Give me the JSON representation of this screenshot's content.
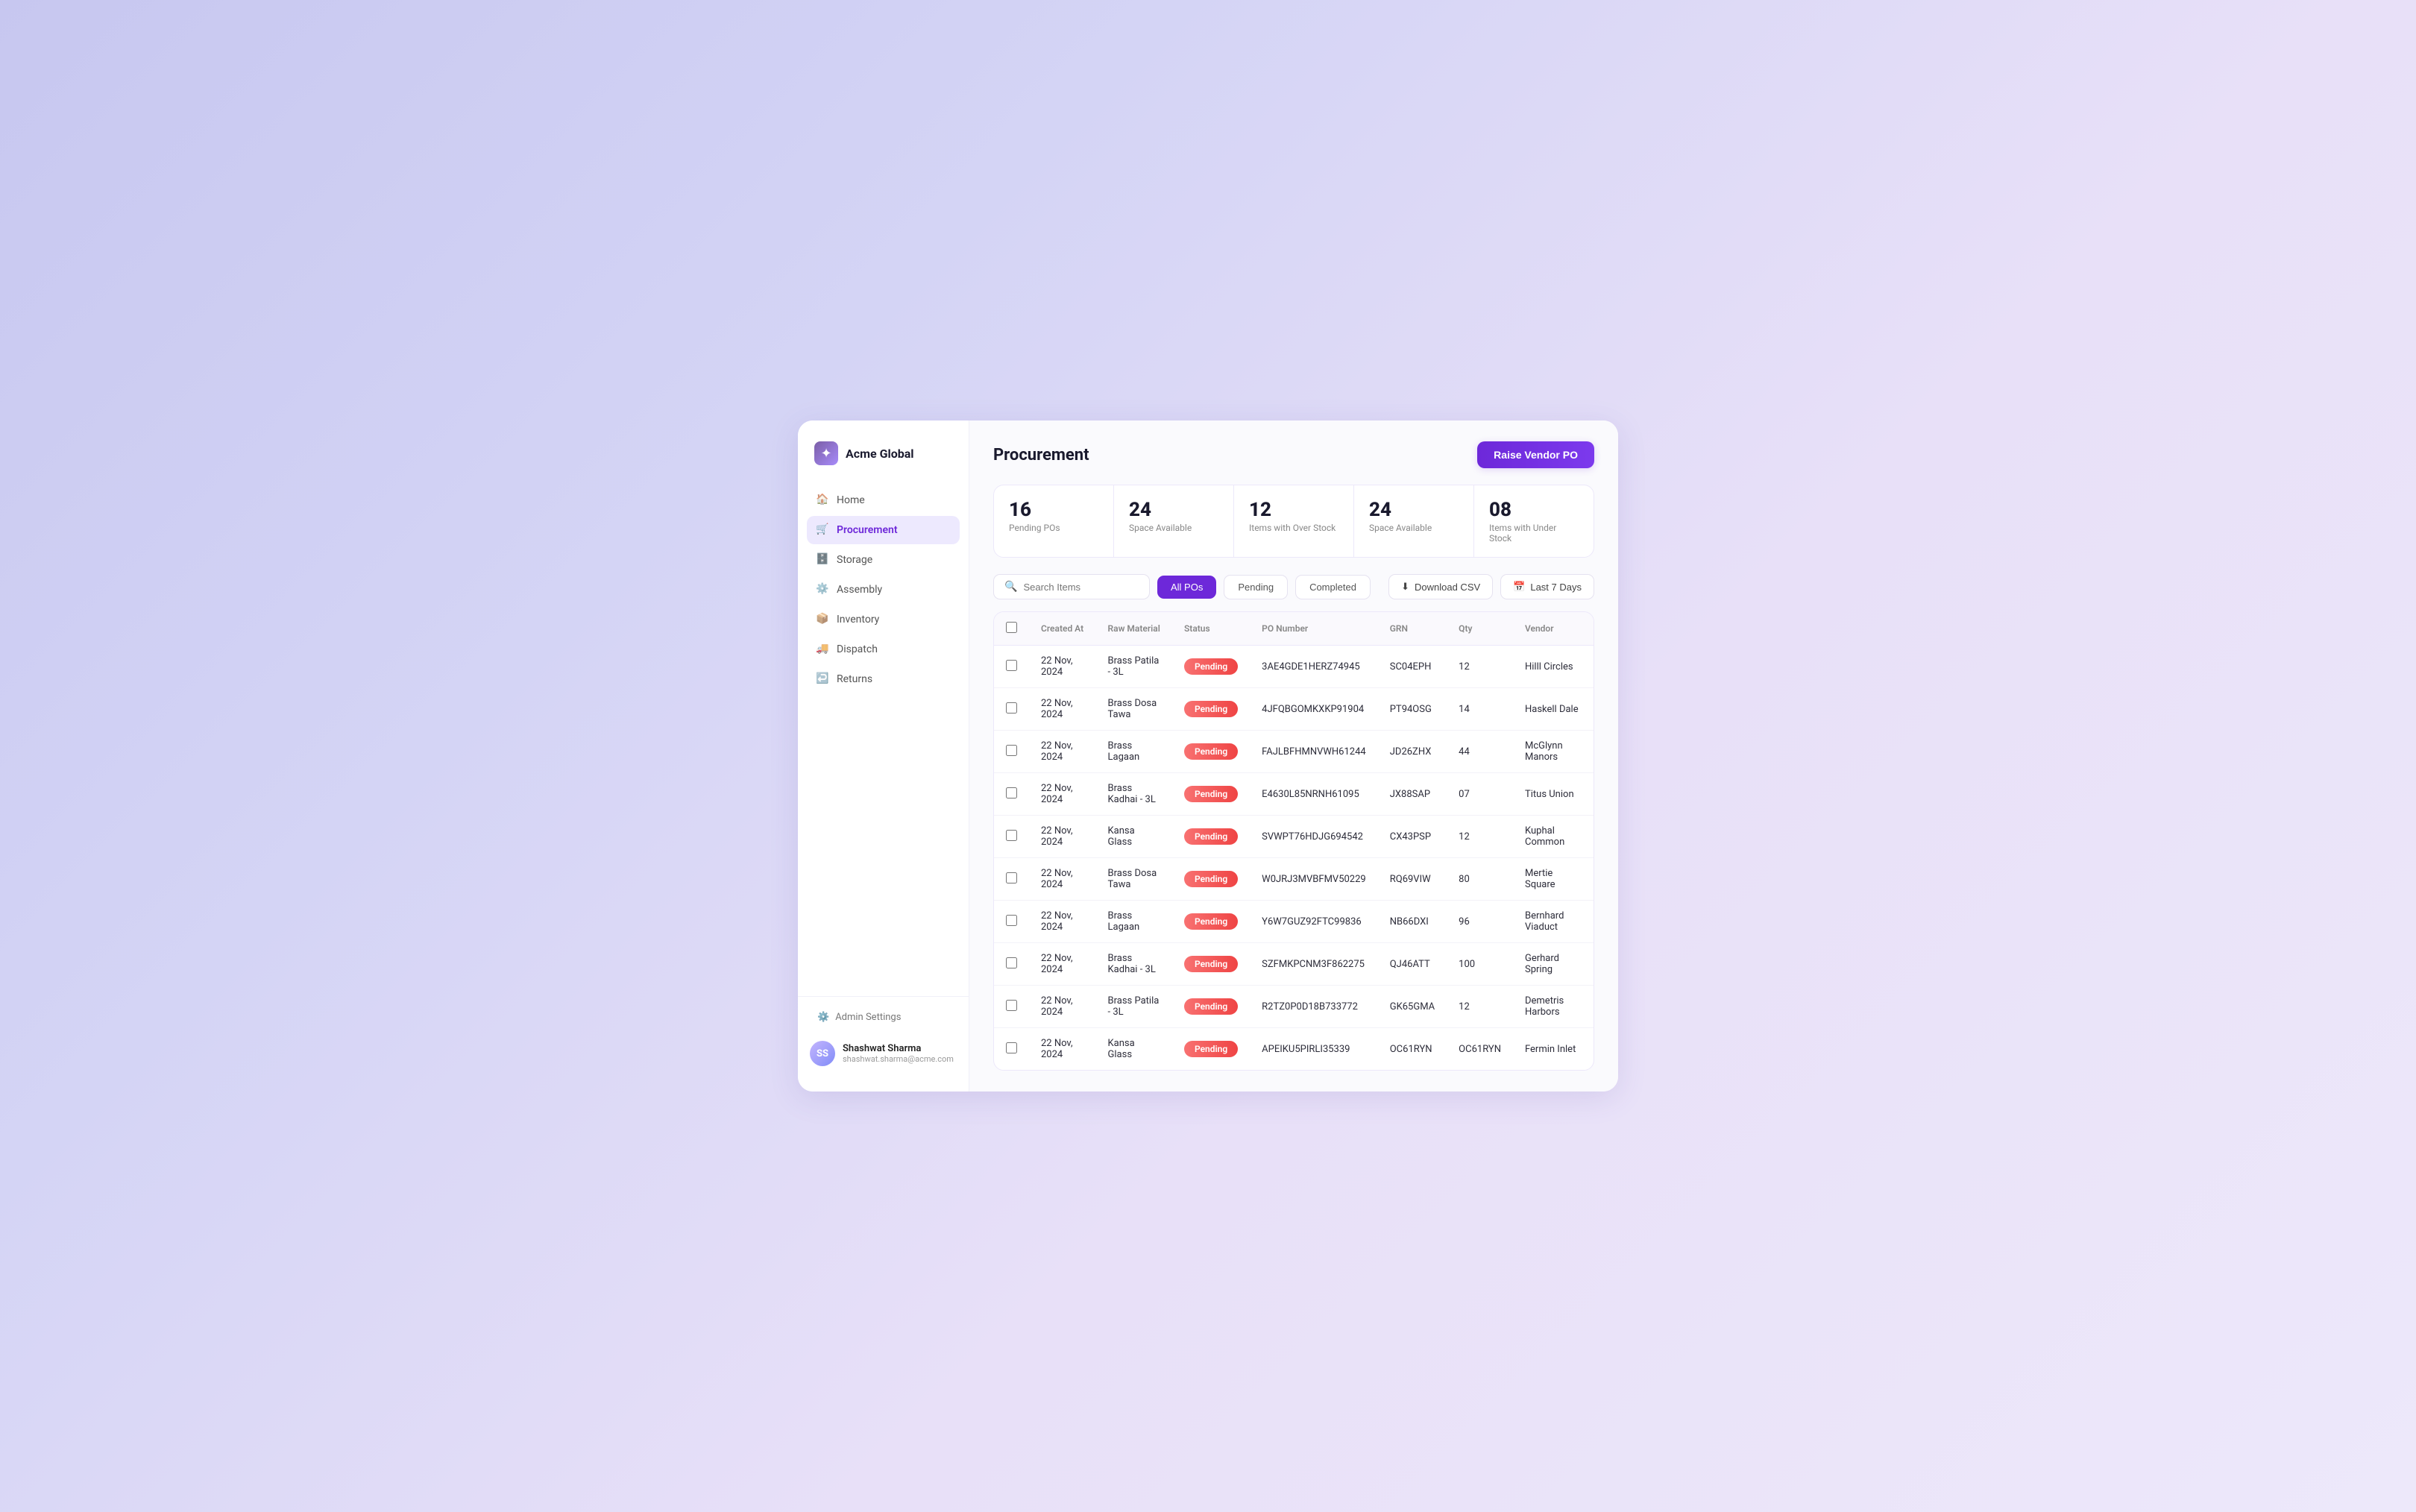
{
  "app": {
    "name": "Acme Global",
    "logo_char": "✦"
  },
  "sidebar": {
    "nav_items": [
      {
        "id": "home",
        "label": "Home",
        "icon": "🏠",
        "active": false
      },
      {
        "id": "procurement",
        "label": "Procurement",
        "icon": "🛒",
        "active": true
      },
      {
        "id": "storage",
        "label": "Storage",
        "icon": "🗄️",
        "active": false
      },
      {
        "id": "assembly",
        "label": "Assembly",
        "icon": "⚙️",
        "active": false
      },
      {
        "id": "inventory",
        "label": "Inventory",
        "icon": "📦",
        "active": false
      },
      {
        "id": "dispatch",
        "label": "Dispatch",
        "icon": "🚚",
        "active": false
      },
      {
        "id": "returns",
        "label": "Returns",
        "icon": "↩️",
        "active": false
      }
    ],
    "admin_settings_label": "Admin Settings",
    "user": {
      "name": "Shashwat Sharma",
      "email": "shashwat.sharma@acme.com",
      "initials": "SS"
    }
  },
  "header": {
    "title": "Procurement",
    "raise_po_label": "Raise Vendor PO"
  },
  "stats": [
    {
      "value": "16",
      "label": "Pending POs"
    },
    {
      "value": "24",
      "label": "Space Available"
    },
    {
      "value": "12",
      "label": "Items with Over Stock"
    },
    {
      "value": "24",
      "label": "Space Available"
    },
    {
      "value": "08",
      "label": "Items with Under Stock"
    }
  ],
  "toolbar": {
    "search_placeholder": "Search Items",
    "filters": [
      {
        "id": "all_pos",
        "label": "All POs",
        "active": true
      },
      {
        "id": "pending",
        "label": "Pending",
        "active": false
      },
      {
        "id": "completed",
        "label": "Completed",
        "active": false
      }
    ],
    "download_csv_label": "Download CSV",
    "date_filter_label": "Last 7 Days"
  },
  "table": {
    "columns": [
      "Created At",
      "Raw Material",
      "Status",
      "PO Number",
      "GRN",
      "Qty",
      "Vendor"
    ],
    "rows": [
      {
        "created_at": "22 Nov, 2024",
        "raw_material": "Brass Patila - 3L",
        "status": "Pending",
        "po_number": "3AE4GDE1HERZ74945",
        "grn": "SC04EPH",
        "qty": "12",
        "vendor": "Hilll Circles"
      },
      {
        "created_at": "22 Nov, 2024",
        "raw_material": "Brass Dosa Tawa",
        "status": "Pending",
        "po_number": "4JFQBGOMKXKP91904",
        "grn": "PT94OSG",
        "qty": "14",
        "vendor": "Haskell Dale"
      },
      {
        "created_at": "22 Nov, 2024",
        "raw_material": "Brass Lagaan",
        "status": "Pending",
        "po_number": "FAJLBFHMNVWH61244",
        "grn": "JD26ZHX",
        "qty": "44",
        "vendor": "McGlynn Manors"
      },
      {
        "created_at": "22 Nov, 2024",
        "raw_material": "Brass Kadhai - 3L",
        "status": "Pending",
        "po_number": "E4630L85NRNH61095",
        "grn": "JX88SAP",
        "qty": "07",
        "vendor": "Titus Union"
      },
      {
        "created_at": "22 Nov, 2024",
        "raw_material": "Kansa Glass",
        "status": "Pending",
        "po_number": "SVWPT76HDJG694542",
        "grn": "CX43PSP",
        "qty": "12",
        "vendor": "Kuphal Common"
      },
      {
        "created_at": "22 Nov, 2024",
        "raw_material": "Brass Dosa Tawa",
        "status": "Pending",
        "po_number": "W0JRJ3MVBFMV50229",
        "grn": "RQ69VIW",
        "qty": "80",
        "vendor": "Mertie Square"
      },
      {
        "created_at": "22 Nov, 2024",
        "raw_material": "Brass Lagaan",
        "status": "Pending",
        "po_number": "Y6W7GUZ92FTC99836",
        "grn": "NB66DXI",
        "qty": "96",
        "vendor": "Bernhard Viaduct"
      },
      {
        "created_at": "22 Nov, 2024",
        "raw_material": "Brass Kadhai - 3L",
        "status": "Pending",
        "po_number": "SZFMKPCNM3F862275",
        "grn": "QJ46ATT",
        "qty": "100",
        "vendor": "Gerhard Spring"
      },
      {
        "created_at": "22 Nov, 2024",
        "raw_material": "Brass Patila - 3L",
        "status": "Pending",
        "po_number": "R2TZ0P0D18B733772",
        "grn": "GK65GMA",
        "qty": "12",
        "vendor": "Demetris Harbors"
      },
      {
        "created_at": "22 Nov, 2024",
        "raw_material": "Kansa Glass",
        "status": "Pending",
        "po_number": "APEIKU5PIRLI35339",
        "grn": "OC61RYN",
        "qty": "OC61RYN",
        "vendor": "Fermin Inlet"
      }
    ]
  }
}
